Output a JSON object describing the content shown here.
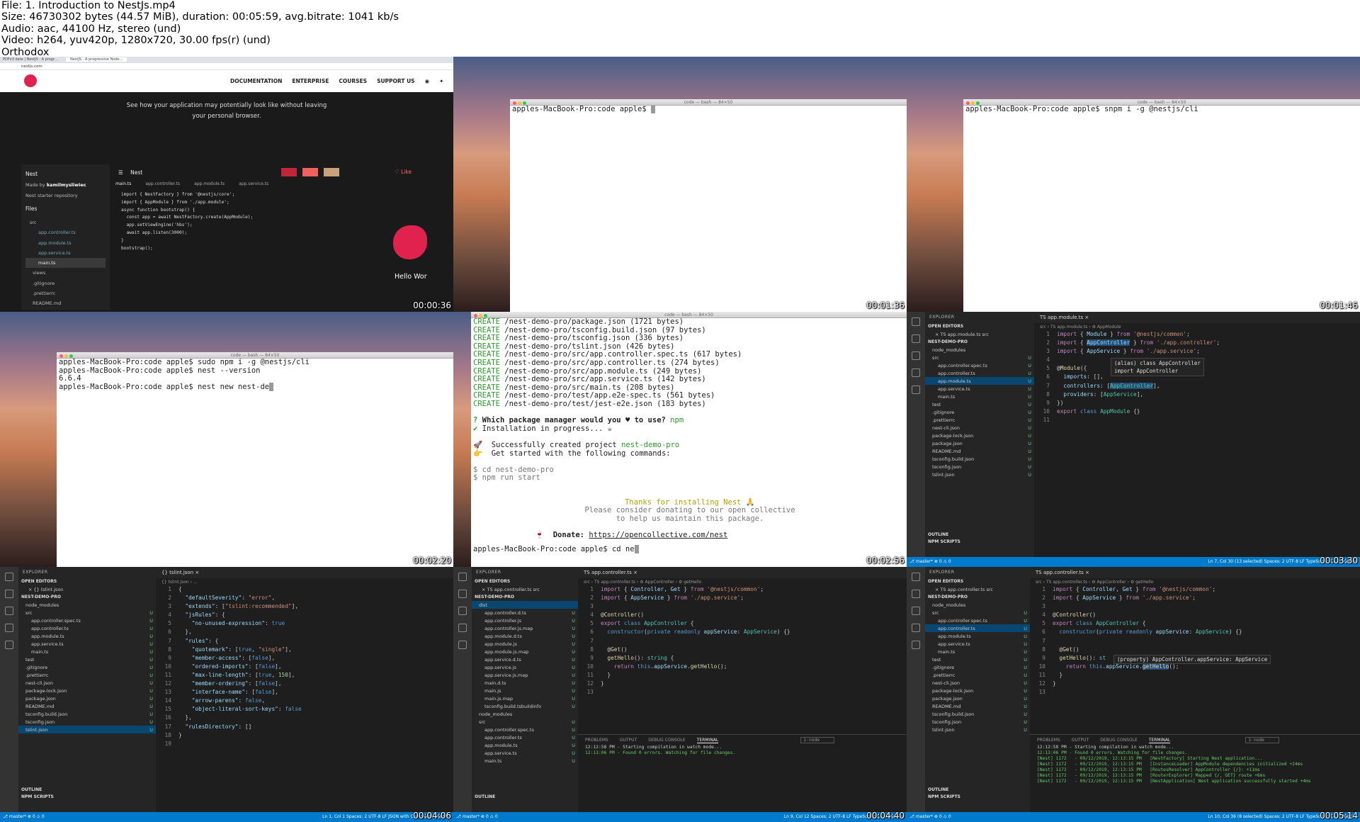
{
  "info": {
    "lines": [
      "File: 1. Introduction to NestJs.mp4",
      "Size: 46730302 bytes (44.57 MiB), duration: 00:05:59, avg.bitrate: 1041 kb/s",
      "Audio: aac, 44100 Hz, stereo (und)",
      "Video: h264, yuv420p, 1280x720, 30.00 fps(r) (und)",
      "Orthodox"
    ]
  },
  "timestamps": [
    "00:00:36",
    "00:01:36",
    "00:01:46",
    "00:02:20",
    "00:02:56",
    "00:03:30",
    "00:04:06",
    "00:04:40",
    "00:05:14"
  ],
  "tile1": {
    "url": "nestjs.com",
    "tab1": "PDFv3 date | NestJS - A progr...",
    "tab2": "NestJS - A progressive Node...",
    "nav": [
      "DOCUMENTATION",
      "ENTERPRISE",
      "COURSES",
      "SUPPORT US"
    ],
    "tagline1": "See how your application may potentially look like without leaving",
    "tagline2": "your personal browser.",
    "sb_title": "Nest",
    "made_by_pre": "Made by ",
    "made_by": "kamilmysliwiec",
    "repo": "Nest starter repository",
    "files": "Files",
    "tree": [
      "src",
      "app.controller.ts",
      "app.module.ts",
      "app.service.ts",
      "main.ts",
      "views",
      ".gitignore",
      ".prettierrc",
      "README.md"
    ],
    "ed_title": "Nest",
    "like": "Like",
    "tabs": [
      "main.ts",
      "app.controller.ts",
      "app.module.ts",
      "app.service.ts"
    ],
    "code": [
      "import { NestFactory } from '@nestjs/core';",
      "import { AppModule } from './app.module';",
      "",
      "async function bootstrap() {",
      "  const app = await NestFactory.create(AppModule);",
      "  app.setViewEngine('hbs');",
      "  await app.listen(3000);",
      "}",
      "bootstrap();",
      ""
    ],
    "hello": "Hello Wor"
  },
  "tile2": {
    "bar": "code — bash — 84×50",
    "prompt": "apples-MacBook-Pro:code apple$ "
  },
  "tile3": {
    "bar": "code — bash — 84×50",
    "prompt": "apples-MacBook-Pro:code apple$ snpm i -g @nestjs/cli"
  },
  "tile4": {
    "bar": "code — bash — 84×50",
    "lines": [
      "apples-MacBook-Pro:code apple$ sudo npm i -g @nestjs/cli",
      "apples-MacBook-Pro:code apple$ nest --version",
      "6.6.4",
      "apples-MacBook-Pro:code apple$ nest new nest-de"
    ]
  },
  "tile5": {
    "bar": "code — bash — 84×50",
    "creates": [
      "/nest-demo-pro/package.json (1721 bytes)",
      "/nest-demo-pro/tsconfig.build.json (97 bytes)",
      "/nest-demo-pro/tsconfig.json (336 bytes)",
      "/nest-demo-pro/tslint.json (426 bytes)",
      "/nest-demo-pro/src/app.controller.spec.ts (617 bytes)",
      "/nest-demo-pro/src/app.controller.ts (274 bytes)",
      "/nest-demo-pro/src/app.module.ts (249 bytes)",
      "/nest-demo-pro/src/app.service.ts (142 bytes)",
      "/nest-demo-pro/src/main.ts (208 bytes)",
      "/nest-demo-pro/test/app.e2e-spec.ts (561 bytes)",
      "/nest-demo-pro/test/jest-e2e.json (183 bytes)"
    ],
    "create_word": "CREATE",
    "q_mark": "?",
    "question": "Which package manager would you ♥ to use?",
    "npm": "npm",
    "check": "✔",
    "install": "Installation in progress... ☕",
    "rocket": "🚀",
    "success": "Successfully created project",
    "project": "nest-demo-pro",
    "hand": "👉",
    "get_started": "Get started with the following commands:",
    "cmd1": "$ cd nest-demo-pro",
    "cmd2": "$ npm run start",
    "thanks": "Thanks for installing Nest 🙏",
    "donate1": "Please consider donating to our open collective",
    "donate2": "to help us maintain this package.",
    "donate_icon": "🍷",
    "donate_label": "Donate:",
    "donate_url": "https://opencollective.com/nest",
    "prompt": "apples-MacBook-Pro:code apple$ cd ne"
  },
  "tile6": {
    "explorer": "EXPLORER",
    "open_editors": "OPEN EDITORS",
    "open_file": "× TS app.module.ts  src",
    "project": "NEST-DEMO-PRO",
    "tree": [
      "node_modules",
      "src",
      "app.controller.spec.ts",
      "app.controller.ts",
      "app.module.ts",
      "app.service.ts",
      "main.ts",
      "test",
      ".gitignore",
      ".prettierrc",
      "nest-cli.json",
      "package-lock.json",
      "package.json",
      "README.md",
      "tsconfig.build.json",
      "tsconfig.json",
      "tslint.json"
    ],
    "tab": "TS app.module.ts ×",
    "crumb": "src › TS app.module.ts › ⚙ AppModule",
    "tooltip1": "(alias) class AppController",
    "tooltip2": "import AppController",
    "outline": "OUTLINE",
    "npm_scripts": "NPM SCRIPTS",
    "status_left": "⎇ master*  ⊗ 0 ⚠ 0",
    "status_right": "Ln 7, Col 30 (13 selected)   Spaces: 2   UTF-8   LF   TypeScript   3.6.2   Prettier"
  },
  "tile7": {
    "open_file": "× {} tslint.json",
    "tab": "{} tslint.json ×",
    "crumb": "{} tslint.json › ...",
    "status_right": "Ln 1, Col 1   Spaces: 2   UTF-8   LF   JSON with Comments   Prettier"
  },
  "tile8": {
    "open_file": "× TS app.controller.ts  src",
    "tab": "TS app.controller.ts ×",
    "crumb": "src › TS app.controller.ts › ⚙ AppController › ⚙ getHello",
    "dist_tree": [
      "dist",
      "app.controller.d.ts",
      "app.controller.js",
      "app.controller.js.map",
      "app.module.d.ts",
      "app.module.js",
      "app.module.js.map",
      "app.service.d.ts",
      "app.service.js",
      "app.service.js.map",
      "main.d.ts",
      "main.js",
      "main.js.map",
      "tsconfig.build.tsbuildinfo",
      "node_modules",
      "src",
      "app.controller.spec.ts",
      "app.controller.ts",
      "app.module.ts",
      "app.service.ts",
      "main.ts"
    ],
    "panel_tabs": [
      "PROBLEMS",
      "OUTPUT",
      "DEBUG CONSOLE",
      "TERMINAL"
    ],
    "node_select": "1: node",
    "term": [
      "12:12:58 PM - Starting compilation in watch mode...",
      "12:13:06 PM - Found 0 errors. Watching for file changes."
    ],
    "status_right": "Ln 9, Col 12   Spaces: 2   UTF-8   LF   TypeScript   3.6.2   Prettier"
  },
  "tile9": {
    "tooltip": "(property) AppController.appService: AppService",
    "term": [
      "12:12:58 PM - Starting compilation in watch mode...",
      "12:13:06 PM - Found 0 errors. Watching for file changes.",
      "",
      "[Nest] 1172   - 09/12/2019, 12:13:15 PM   [NestFactory] Starting Nest application...",
      "[Nest] 1172   - 09/12/2019, 12:13:15 PM   [InstanceLoader] AppModule dependencies initialized +24ms",
      "[Nest] 1172   - 09/12/2019, 12:13:15 PM   [RoutesResolver] AppController {/}: +11ms",
      "[Nest] 1172   - 09/12/2019, 12:13:15 PM   [RouterExplorer] Mapped {/, GET} route +6ms",
      "[Nest] 1172   - 09/12/2019, 12:13:15 PM   [NestApplication] Nest application successfully started +4ms"
    ],
    "status_right": "Ln 10, Col 36 (8 selected)   Spaces: 2   UTF-8   LF   TypeScript   3.6.2   Prettier"
  },
  "colors": {
    "vscode_blue": "#007acc",
    "nest_red": "#e0234e",
    "term_green": "#2a9a2a"
  }
}
